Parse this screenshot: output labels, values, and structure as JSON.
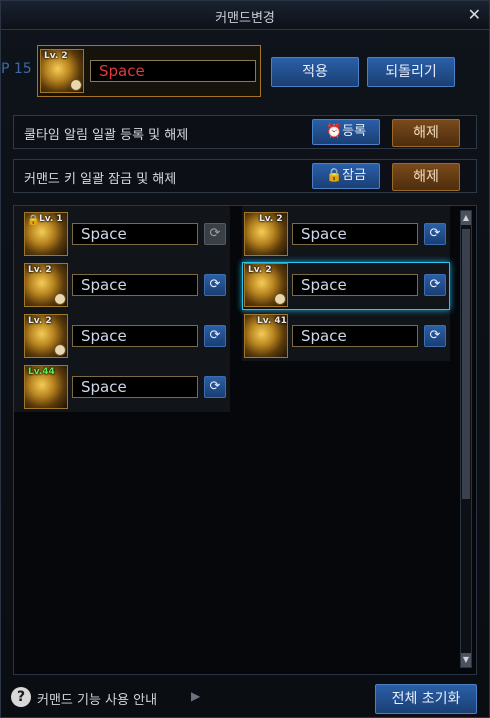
{
  "window": {
    "title": "커맨드변경",
    "close_symbol": "✕"
  },
  "background": {
    "left_fragment": "P 15"
  },
  "selected": {
    "level": "Lv. 2",
    "command": "Space",
    "apply_label": "적용",
    "revert_label": "되돌리기"
  },
  "cooltime_row": {
    "label": "쿨타임 알림 일괄 등록 및 해제",
    "register_label": "등록",
    "release_label": "해제"
  },
  "lock_row": {
    "label": "커맨드 키 일괄 잠금 및 해제",
    "lock_label": "잠금",
    "release_label": "해제"
  },
  "skills_left": [
    {
      "level": "Lv. 1",
      "command": "Space",
      "locked": true
    },
    {
      "level": "Lv. 2",
      "command": "Space"
    },
    {
      "level": "Lv. 2",
      "command": "Space"
    },
    {
      "level": "Lv.44",
      "command": "Space"
    }
  ],
  "skills_right": [
    {
      "level": "Lv. 2",
      "command": "Space"
    },
    {
      "level": "Lv. 2",
      "command": "Space",
      "selected": true
    },
    {
      "level": "Lv. 41",
      "command": "Space"
    }
  ],
  "footer": {
    "help_symbol": "?",
    "help_label": "커맨드 기능 사용 안내",
    "reset_all_label": "전체 초기화"
  },
  "colors": {
    "accent_blue": "#2a5fa7",
    "highlight_cyan": "#27c6f1",
    "brown_button": "#7a4a1b",
    "command_red": "#e23a3a"
  }
}
